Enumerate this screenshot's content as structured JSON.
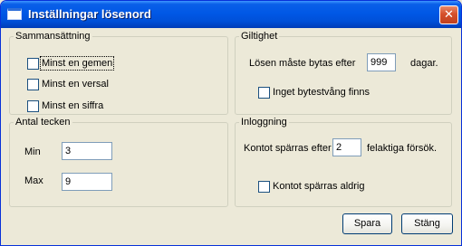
{
  "window": {
    "title": "Inställningar lösenord",
    "close_glyph": "✕"
  },
  "composition": {
    "legend": "Sammansättning",
    "items": [
      {
        "label": "Minst en gemen",
        "checked": false
      },
      {
        "label": "Minst en versal",
        "checked": false
      },
      {
        "label": "Minst en siffra",
        "checked": false
      }
    ]
  },
  "char_count": {
    "legend": "Antal tecken",
    "min_label": "Min",
    "min_value": "3",
    "max_label": "Max",
    "max_value": "9"
  },
  "validity": {
    "legend": "Giltighet",
    "change_label": "Lösen måste bytas efter",
    "days_value": "999",
    "days_unit": "dagar.",
    "no_force_label": "Inget bytestvång finns",
    "no_force_checked": false
  },
  "login": {
    "legend": "Inloggning",
    "lock_label": "Kontot spärras efter",
    "attempts_value": "2",
    "attempts_suffix": "felaktiga försök.",
    "never_lock_label": "Kontot spärras aldrig",
    "never_lock_checked": false
  },
  "buttons": {
    "save": "Spara",
    "close": "Stäng"
  },
  "colors": {
    "titlebar": "#0058e6",
    "close_button": "#d5502a",
    "dialog_bg": "#ece9d8"
  }
}
